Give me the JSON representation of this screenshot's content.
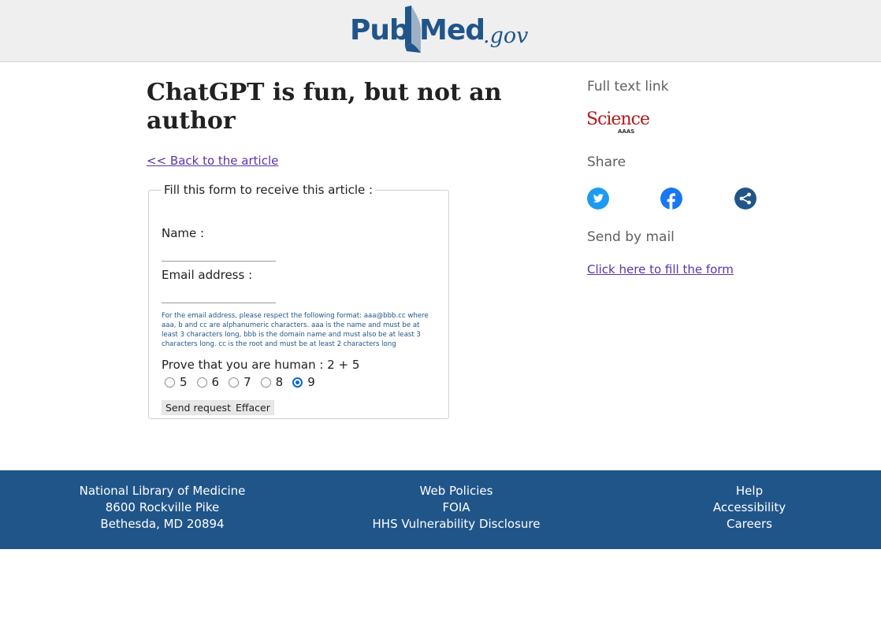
{
  "header": {
    "logo_pub": "Pub",
    "logo_med": "Med",
    "logo_gov": ".gov"
  },
  "article": {
    "title": "ChatGPT is fun, but not an author",
    "back_link": "<< Back to the article"
  },
  "form": {
    "legend": "Fill this form to receive this article :",
    "name_label": "Name :",
    "name_value": "",
    "email_label": "Email address :",
    "email_value": "",
    "hint": "For the email address, please respect the following format: aaa@bbb.cc where aaa, b and cc are alphanumeric characters. aaa is the name and must be at least 3 characters long, bbb is the domain name and must also be at least 3 characters long. cc is the root and must be at least 2 characters long",
    "captcha_label": "Prove that you are human : 2 + 5",
    "options": [
      "5",
      "6",
      "7",
      "8",
      "9"
    ],
    "selected_option": "9",
    "send_button": "Send request",
    "reset_button": "Effacer"
  },
  "sidebar": {
    "full_text_heading": "Full text link",
    "science_logo_text": "Science",
    "science_logo_sub": "AAAS",
    "share_heading": "Share",
    "send_mail_heading": "Send by mail",
    "mail_link": "Click here to fill the form"
  },
  "footer": {
    "col1": [
      "National Library of Medicine",
      "8600 Rockville Pike",
      "Bethesda, MD 20894"
    ],
    "col2": [
      "Web Policies",
      "FOIA",
      "HHS Vulnerability Disclosure"
    ],
    "col3": [
      "Help",
      "Accessibility",
      "Careers"
    ]
  },
  "colors": {
    "brand_blue": "#20558a",
    "link_purple": "#5b34a6",
    "twitter": "#1d9bf0",
    "facebook": "#1877f2",
    "share": "#20558a",
    "science_red": "#b31b1b"
  }
}
